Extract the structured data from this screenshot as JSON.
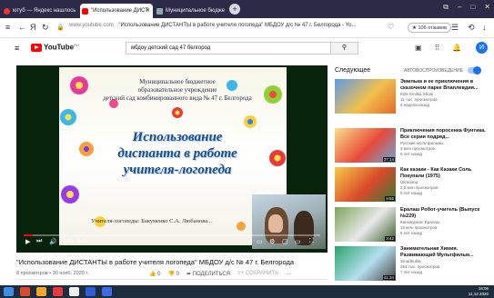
{
  "tabs": [
    {
      "label": "ютуб — Яндекс нашлось",
      "favicon": "yandex-icon",
      "color": "#e33"
    },
    {
      "label": "\"Использование ДИСТ",
      "favicon": "youtube-icon",
      "color": "#f00"
    },
    {
      "label": "Муниципальное бюдже",
      "favicon": "page-icon",
      "color": "#8aa"
    }
  ],
  "address": {
    "domain": "www.youtube.com",
    "title": "\"Использование ДИСТАНТЫ в работе учителя логопеда\" МБДОУ д/с № 47 г. Белгорода - Yo...",
    "reviews": "★ 106 отзывов"
  },
  "youtube": {
    "logo_text": "YouTube",
    "region": "RU",
    "search_value": "мбдоу детский сад 47 белгород",
    "avatar_letter": "И"
  },
  "video": {
    "slide_org": [
      "Муниципальное бюджетное",
      "образовательное учреждение",
      "детский сад комбинированного вида № 47 г. Белгорода"
    ],
    "slide_title": [
      "Использование",
      "дистанта в работе",
      "учителя-логопеда"
    ],
    "slide_author": "Учителя-логопеды: Бакуменко С.А. Любанова...",
    "time": "0:12 / 6:41",
    "progress": 0.03,
    "title": "\"Использование ДИСТАНТЫ в работе учителя логопеда\" МБДОУ д/с № 47 г. Белгорода",
    "meta": "8 просмотров • 30 нояб. 2020 г.",
    "likes": "0",
    "dislikes": "0",
    "share": "ПОДЕЛИТЬСЯ",
    "save": "СОХРАНИТЬ"
  },
  "sidebar": {
    "next_label": "Следующее",
    "autoplay_label": "АВТОВОСПРОИЗВЕДЕНИЕ",
    "items": [
      {
        "title": "Эмилька и ее приключения в сказочном парке Bnanлевдия...",
        "channel": "Kids Emilka Show",
        "views": "11 тыс. просмотров",
        "ago": "4 недели назад",
        "duration": "",
        "colors": [
          "#5d9be8",
          "#f2c14e",
          "#e36b2b"
        ]
      },
      {
        "title": "Приключения поросенка Фунтика. Все серии подряд...",
        "channel": "Русские мультфильмы",
        "views": "3 млн просмотров",
        "ago": "5 лет назад",
        "duration": "37:14",
        "colors": [
          "#fbe08a",
          "#e84a3a",
          "#65a7d9"
        ]
      },
      {
        "title": "Как казаки - Как Казаки Соль Покупали (1975)",
        "channel": "Ukranima",
        "views": "2,5 млн просмотров",
        "ago": "5 лет назад",
        "duration": "9:55",
        "colors": [
          "#f7c948",
          "#d94a2a",
          "#3a7a3a"
        ]
      },
      {
        "title": "Ералаш Робот-учитель (Выпуск №229)",
        "channel": "Киножурнал Ералаш",
        "views": "15 млн просмотров",
        "ago": "5 лет назад",
        "duration": "3:42",
        "colors": [
          "#7da65a",
          "#e9e9e9",
          "#3b5e2a"
        ]
      },
      {
        "title": "Занимательная Химия. Развивающий Мультфильм...",
        "channel": "Smartkukla",
        "views": "264 тыс. просмотров",
        "ago": "7 лет назад",
        "duration": "41:34",
        "colors": [
          "#2aa36b",
          "#b5e0f0",
          "#444"
        ]
      }
    ]
  },
  "taskbar": {
    "time": "18:06",
    "date": "11.12.2020"
  }
}
